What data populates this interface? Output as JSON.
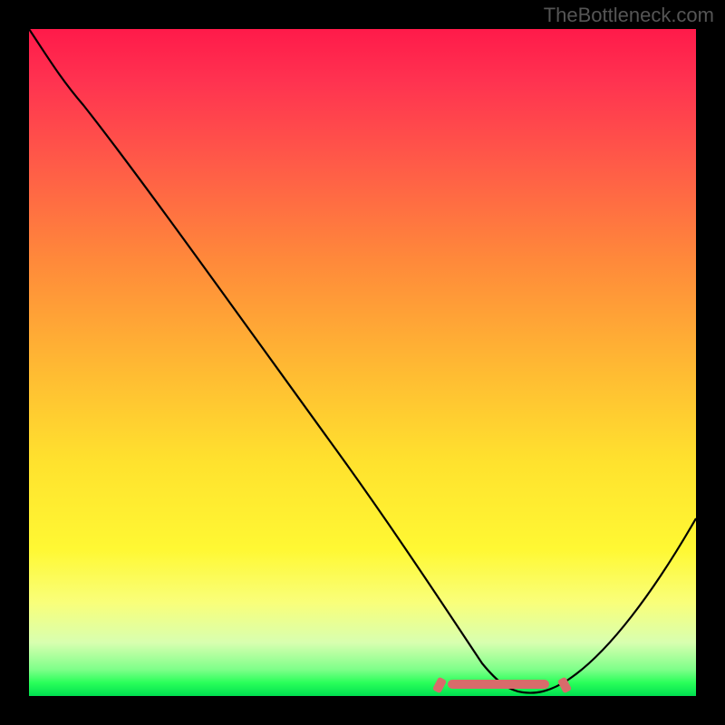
{
  "watermark": "TheBottleneck.com",
  "chart_data": {
    "type": "line",
    "title": "",
    "xlabel": "",
    "ylabel": "",
    "xlim": [
      0,
      100
    ],
    "ylim": [
      0,
      100
    ],
    "grid": false,
    "legend": false,
    "series": [
      {
        "name": "curve",
        "color": "#000000",
        "x": [
          0,
          4,
          10,
          20,
          30,
          40,
          50,
          58,
          62,
          66,
          70,
          74,
          78,
          84,
          90,
          96,
          100
        ],
        "y": [
          100,
          96,
          89,
          76,
          63,
          50,
          37,
          24,
          16,
          8,
          2,
          0,
          0,
          4,
          12,
          22,
          30
        ]
      }
    ],
    "highlight_region": {
      "x_start": 62,
      "x_end": 80,
      "color": "#d86b6b"
    },
    "background_gradient": {
      "top": "#ff1a4a",
      "mid": "#ffe22e",
      "bottom": "#00e050"
    }
  }
}
